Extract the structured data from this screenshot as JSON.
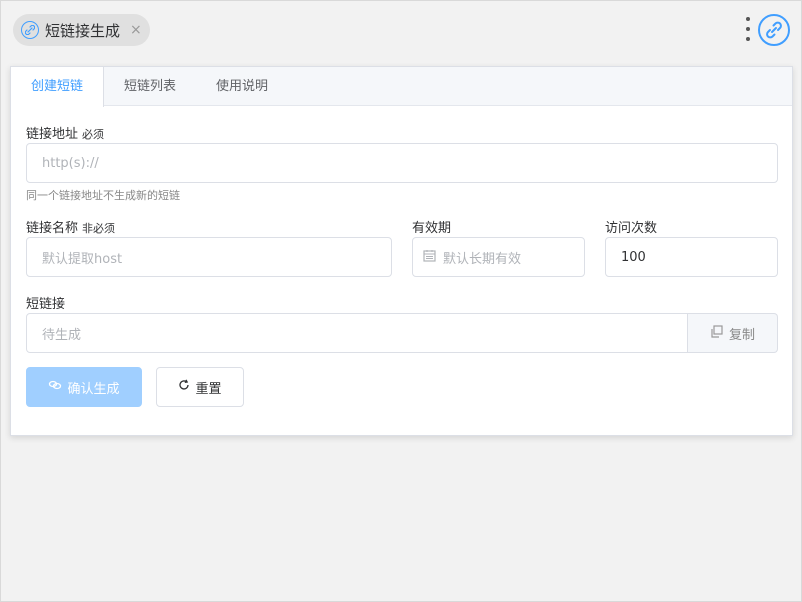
{
  "tab_pill": {
    "label": "短链接生成",
    "close": "×"
  },
  "tabs": [
    {
      "label": "创建短链"
    },
    {
      "label": "短链列表"
    },
    {
      "label": "使用说明"
    }
  ],
  "form": {
    "url": {
      "label": "链接地址",
      "tag": "必须",
      "placeholder": "http(s)://",
      "hint": "同一个链接地址不生成新的短链"
    },
    "name": {
      "label": "链接名称",
      "tag": "非必须",
      "placeholder": "默认提取host"
    },
    "expiry": {
      "label": "有效期",
      "placeholder": "默认长期有效"
    },
    "visits": {
      "label": "访问次数",
      "value": "100"
    },
    "short": {
      "label": "短链接",
      "placeholder": "待生成",
      "copy_label": "复制"
    }
  },
  "buttons": {
    "confirm": "确认生成",
    "reset": "重置"
  },
  "colors": {
    "accent": "#409eff",
    "primary_disabled": "#a0cfff"
  }
}
